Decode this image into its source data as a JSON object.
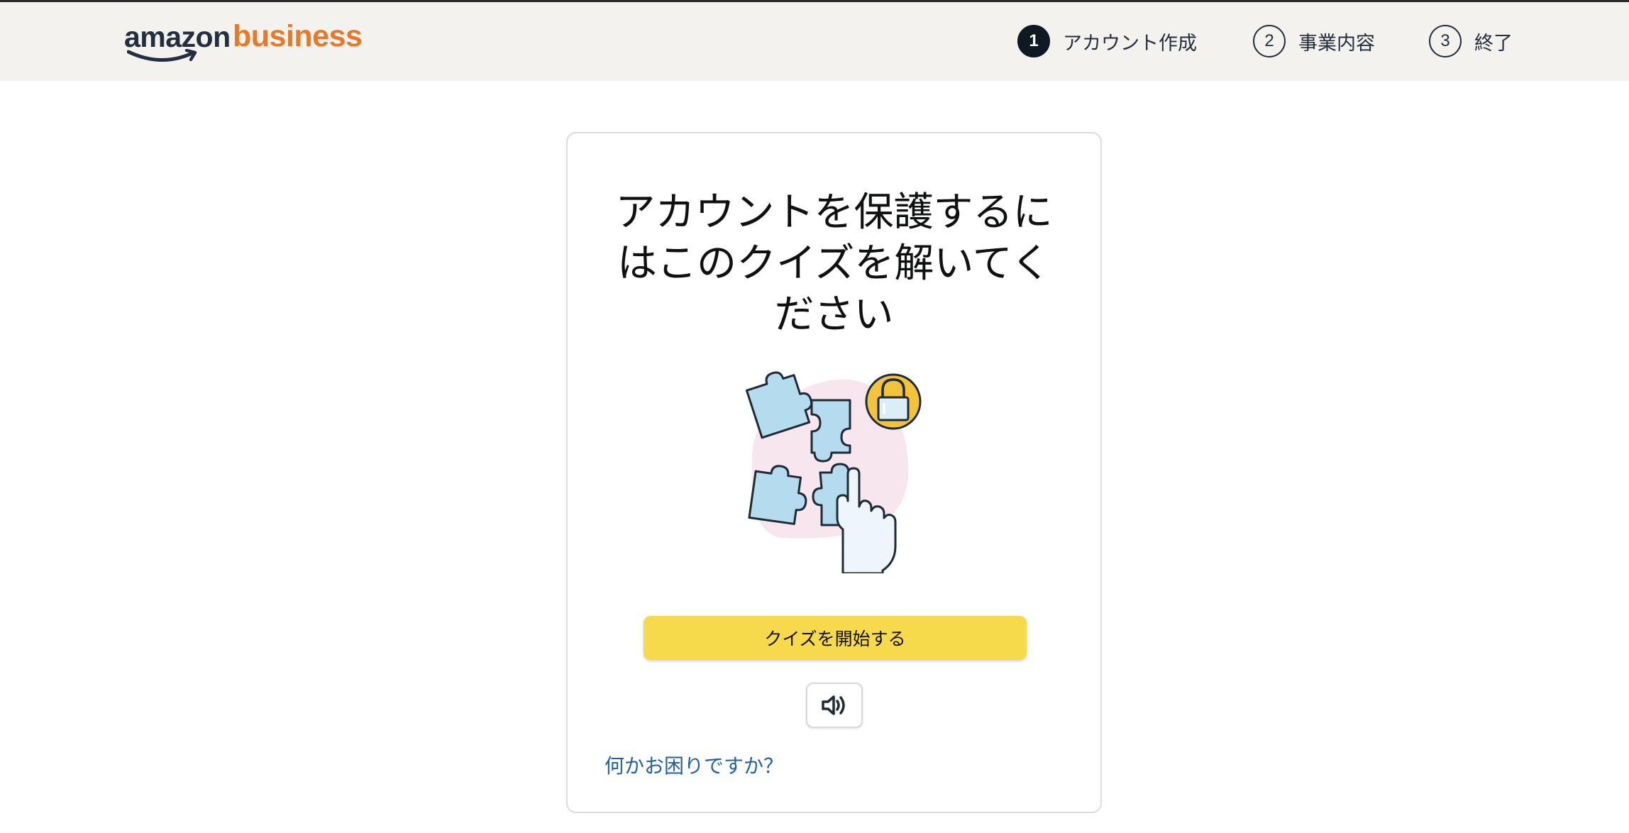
{
  "header": {
    "logo": {
      "brand_left": "amazon",
      "brand_right": "business",
      "brand_right_color": "#e7792b",
      "icon": "amazon-smile-icon"
    },
    "steps": [
      {
        "number": "1",
        "label": "アカウント作成",
        "active": true
      },
      {
        "number": "2",
        "label": "事業内容",
        "active": false
      },
      {
        "number": "3",
        "label": "終了",
        "active": false
      }
    ]
  },
  "card": {
    "title_lines": [
      "アカウントを保護するに",
      "はこのクイズを解いてく",
      "ださい"
    ],
    "illustration_icon": "puzzle-lock-icon",
    "start_button_label": "クイズを開始する",
    "start_button_color": "#f7d94c",
    "audio_button_icon": "speaker-icon",
    "help_link_text": "何かお困りですか？",
    "link_color": "#2162a1"
  }
}
